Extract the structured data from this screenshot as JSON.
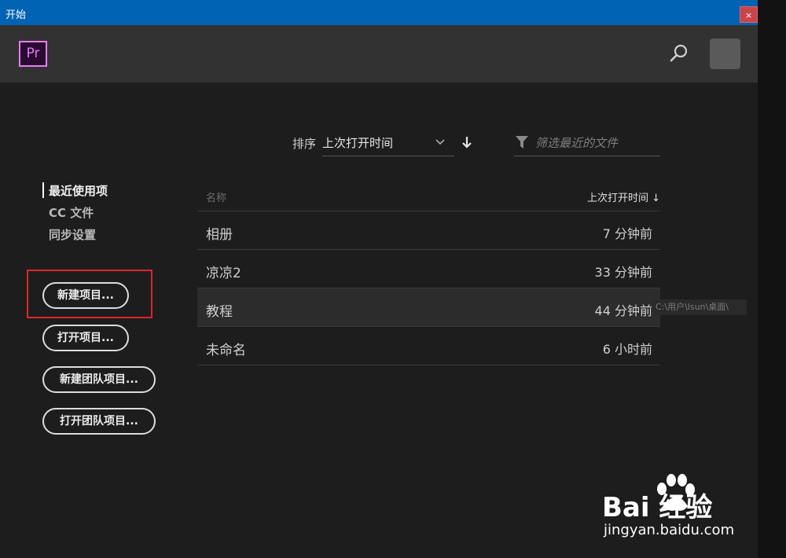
{
  "window": {
    "title": "开始",
    "close_label": "×"
  },
  "header": {
    "logo_text": "Pr"
  },
  "sort": {
    "label": "排序",
    "value": "上次打开时间"
  },
  "filter": {
    "placeholder": "筛选最近的文件"
  },
  "nav": {
    "items": [
      {
        "label": "最近使用项",
        "active": true
      },
      {
        "label": "CC 文件",
        "active": false
      },
      {
        "label": "同步设置",
        "active": false
      }
    ]
  },
  "buttons": {
    "new_project": "新建项目...",
    "open_project": "打开项目...",
    "new_team_project": "新建团队项目...",
    "open_team_project": "打开团队项目..."
  },
  "table": {
    "col_name": "名称",
    "col_time": "上次打开时间 ↓",
    "rows": [
      {
        "name": "相册",
        "time": "7 分钟前"
      },
      {
        "name": "凉凉2",
        "time": "33 分钟前"
      },
      {
        "name": "教程",
        "time": "44 分钟前"
      },
      {
        "name": "未命名",
        "time": "6 小时前"
      }
    ],
    "tooltip": "C:\\用户\\lsun\\桌面\\"
  },
  "watermark": {
    "brand": "Bai  经验",
    "url": "jingyan.baidu.com"
  },
  "colors": {
    "titlebar": "#0062b3",
    "highlight": "#e0262b",
    "pr_accent": "#e57cf5"
  }
}
